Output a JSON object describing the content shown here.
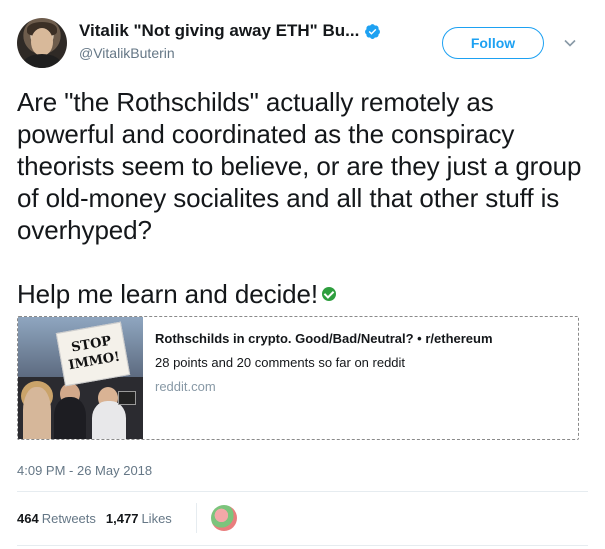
{
  "author": {
    "display_name": "Vitalik \"Not giving away ETH\" Bu...",
    "handle": "@VitalikButerin",
    "verified": true
  },
  "follow_button": {
    "label": "Follow"
  },
  "tweet": {
    "paragraph1": "Are \"the Rothschilds\" actually remotely as powerful and coordinated as the conspiracy theorists seem to believe, or are they just a group of old-money socialites and all that other stuff is overhyped?",
    "paragraph2": "Help me learn and decide!"
  },
  "card": {
    "image_sign_line1": "STOP",
    "image_sign_line2": "IMMO!",
    "title": "Rothschilds in crypto. Good/Bad/Neutral? • r/ethereum",
    "description": "28 points and 20 comments so far on reddit",
    "domain": "reddit.com"
  },
  "timestamp": "4:09 PM - 26 May 2018",
  "stats": {
    "retweets_count": "464",
    "retweets_label": "Retweets",
    "likes_count": "1,477",
    "likes_label": "Likes"
  },
  "colors": {
    "accent": "#1da1f2",
    "text": "#14171a",
    "muted": "#657786",
    "check_emoji": "#2e9e3e"
  },
  "icons": [
    "verified-badge-icon",
    "chevron-down-icon",
    "check-mark-emoji-icon"
  ]
}
